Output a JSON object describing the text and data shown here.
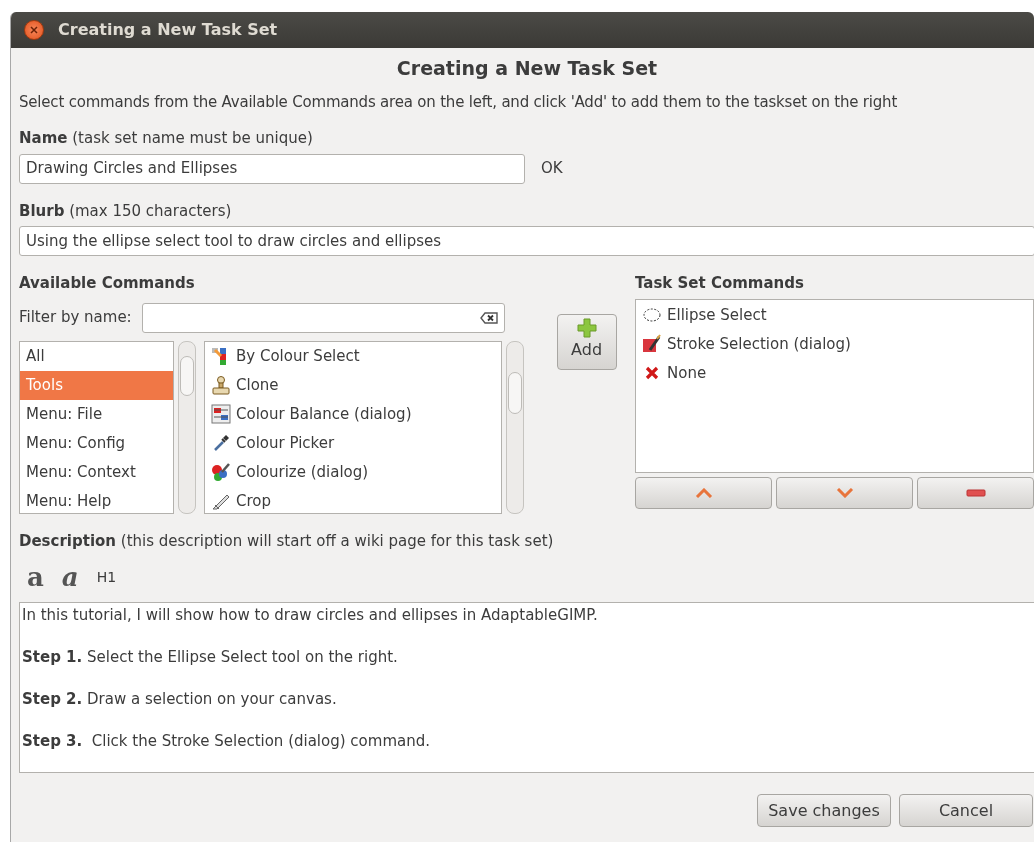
{
  "window": {
    "title": "Creating a New Task Set"
  },
  "heading": "Creating a New Task Set",
  "instructions": "Select commands from the Available Commands area on the left, and click 'Add' to add them to the taskset on the right",
  "name_field": {
    "label": "Name",
    "hint": "(task set name must be unique)",
    "value": "Drawing Circles and Ellipses",
    "status": "OK"
  },
  "blurb_field": {
    "label": "Blurb",
    "hint": "(max 150 characters)",
    "value": "Using the ellipse select tool to draw circles and ellipses"
  },
  "available_commands": {
    "title": "Available Commands",
    "filter_label": "Filter by name:",
    "categories": [
      {
        "label": "All",
        "selected": false
      },
      {
        "label": "Tools",
        "selected": true
      },
      {
        "label": "Menu: File",
        "selected": false
      },
      {
        "label": "Menu: Config",
        "selected": false
      },
      {
        "label": "Menu: Context",
        "selected": false
      },
      {
        "label": "Menu: Help",
        "selected": false
      }
    ],
    "commands": [
      {
        "label": "By Colour Select",
        "kind": "fuzzy"
      },
      {
        "label": "Clone",
        "kind": "stamp"
      },
      {
        "label": "Colour Balance (dialog)",
        "kind": "balance"
      },
      {
        "label": "Colour Picker",
        "kind": "picker"
      },
      {
        "label": "Colourize (dialog)",
        "kind": "colorize"
      },
      {
        "label": "Crop",
        "kind": "crop"
      }
    ]
  },
  "add_button": {
    "label": "Add"
  },
  "task_set": {
    "title": "Task Set Commands",
    "commands": [
      {
        "label": "Ellipse Select",
        "kind": "ellipse"
      },
      {
        "label": "Stroke Selection (dialog)",
        "kind": "stroke"
      },
      {
        "label": "None",
        "kind": "none"
      }
    ]
  },
  "description": {
    "label": "Description",
    "hint": "(this description will start off a wiki page for this task set)",
    "toolbar": [
      {
        "label": "a",
        "kind": "bold"
      },
      {
        "label": "a",
        "kind": "italic"
      },
      {
        "label": "H1",
        "kind": "heading"
      }
    ],
    "paragraphs": [
      "In this tutorial, I will show how to draw circles and ellipses in AdaptableGIMP.",
      "**Step 1.** Select the Ellipse Select tool on the right.",
      "**Step 2.** Draw a selection on your canvas.",
      "**Step 3.**  Click the Stroke Selection (dialog) command."
    ]
  },
  "buttons": [
    {
      "label": "Save changes"
    },
    {
      "label": "Cancel"
    }
  ]
}
